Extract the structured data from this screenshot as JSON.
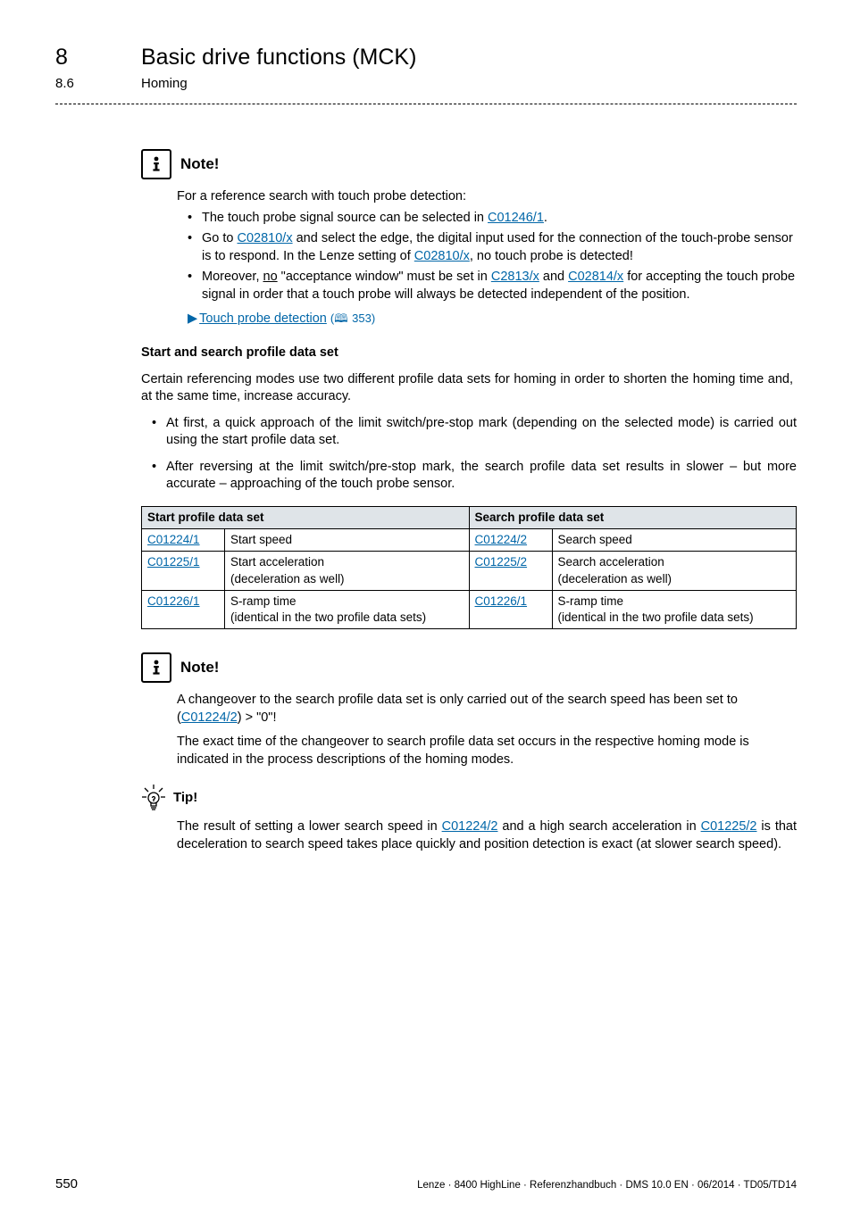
{
  "header": {
    "chapter_num": "8",
    "chapter_title": "Basic drive functions (MCK)",
    "sub_num": "8.6",
    "sub_title": "Homing"
  },
  "note1": {
    "label": "Note!",
    "intro": "For a reference search with touch probe detection:",
    "bullets": [
      {
        "pre": "The touch probe signal source can be selected in ",
        "link": "C01246/1",
        "post": "."
      },
      {
        "pre": "Go to ",
        "link": "C02810/x",
        "mid": " and select the edge, the digital input used for the connection of the touch-probe sensor is to respond. In the Lenze setting of ",
        "link2": "C02810/x",
        "post": ", no touch probe is detected!"
      },
      {
        "pre": "Moreover, ",
        "u": "no",
        "mid": " \"acceptance window\" must be set in ",
        "link": "C2813/x",
        "mid2": " and ",
        "link2": "C02814/x",
        "post": " for accepting the touch probe signal in order that a touch probe will always be detected independent of the position."
      }
    ],
    "arrow_text": "Touch probe detection",
    "arrow_page": "353"
  },
  "section1": {
    "heading": "Start and search profile data set",
    "para1": "Certain referencing modes use two different profile data sets for homing in order to shorten the homing time and, at the same time, increase accuracy.",
    "bullets": [
      "At first, a quick approach of the limit switch/pre-stop mark (depending on the selected mode) is carried out using the start profile data set.",
      "After reversing at the limit switch/pre-stop mark, the search profile data set results in slower – but more accurate – approaching of the touch probe sensor."
    ]
  },
  "table": {
    "head_left": "Start profile data set",
    "head_right": "Search profile data set",
    "rows": [
      {
        "l_code": "C01224/1",
        "l_text": "Start speed",
        "r_code": "C01224/2",
        "r_text": "Search speed"
      },
      {
        "l_code": "C01225/1",
        "l_text": "Start acceleration\n(deceleration as well)",
        "r_code": "C01225/2",
        "r_text": "Search acceleration\n(deceleration as well)"
      },
      {
        "l_code": "C01226/1",
        "l_text": "S-ramp time\n(identical in the two profile data sets)",
        "r_code": "C01226/1",
        "r_text": "S-ramp time\n(identical in the two profile data sets)"
      }
    ]
  },
  "note2": {
    "label": "Note!",
    "p1_pre": "A changeover to the search profile data set is only carried out of the search speed has been set to (",
    "p1_link": "C01224/2",
    "p1_post": ") > \"0\"!",
    "p2": "The exact time of the changeover to search profile data set occurs in the respective homing mode is indicated in the process descriptions of the homing modes."
  },
  "tip": {
    "label": "Tip!",
    "pre": "The result of setting a lower search speed in ",
    "link1": "C01224/2",
    "mid": " and a high search acceleration in ",
    "link2": "C01225/2",
    "post": " is that deceleration to search speed takes place quickly and position detection is exact (at slower search speed)."
  },
  "footer": {
    "page": "550",
    "text": "Lenze · 8400 HighLine · Referenzhandbuch · DMS 10.0 EN · 06/2014 · TD05/TD14"
  }
}
